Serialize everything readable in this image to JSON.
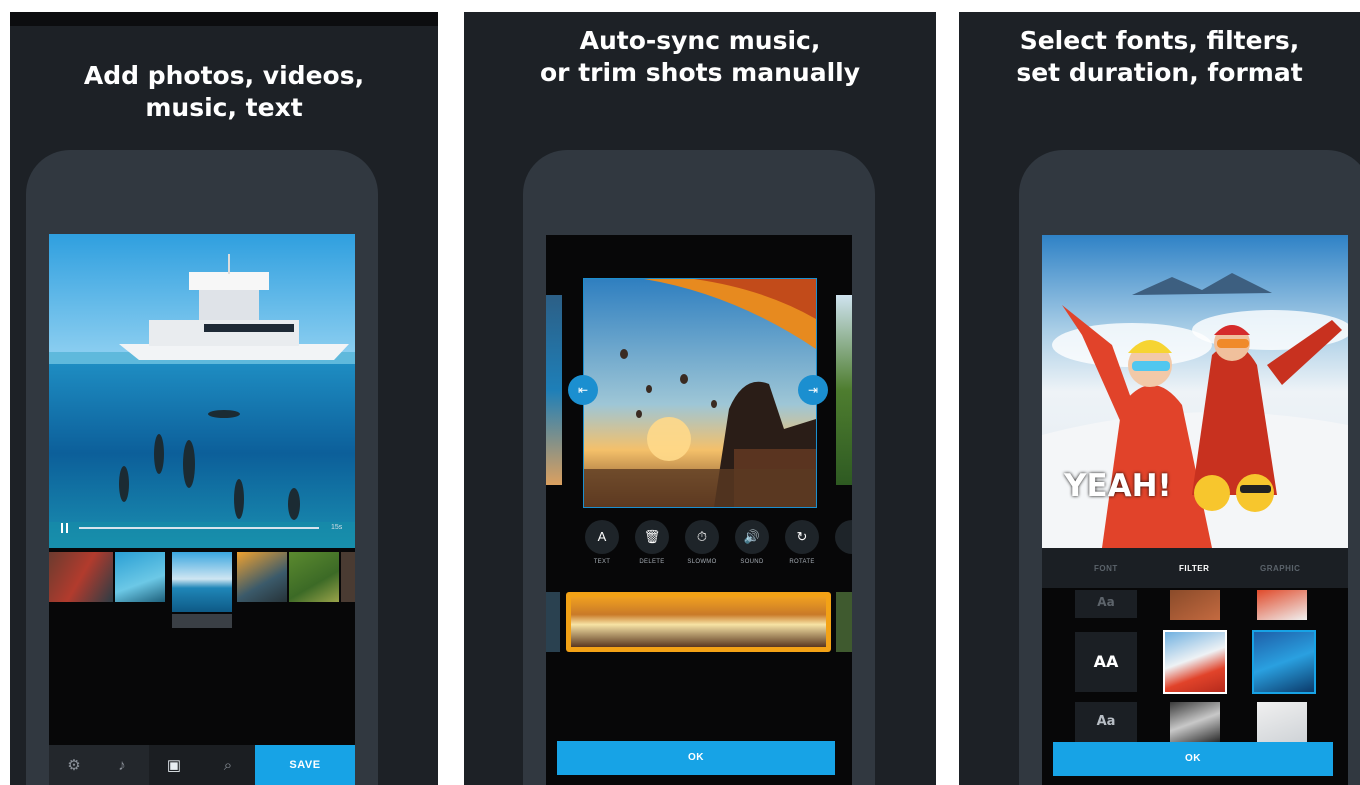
{
  "panels": [
    {
      "headline": [
        "Add photos, videos,",
        "music, text"
      ]
    },
    {
      "headline": [
        "Auto-sync music,",
        "or trim shots manually"
      ]
    },
    {
      "headline": [
        "Select fonts, filters,",
        "set duration, format"
      ]
    }
  ],
  "editor1": {
    "play_icon": "pause-icon",
    "elapsed": "15s",
    "save_label": "SAVE",
    "toolbar_icons": [
      "filter-icon",
      "music-icon",
      "media-icon",
      "search-icon"
    ]
  },
  "editor2": {
    "tools": [
      {
        "icon": "text-icon",
        "glyph": "A",
        "label": "TEXT"
      },
      {
        "icon": "delete-icon",
        "glyph": "🗑",
        "label": "DELETE"
      },
      {
        "icon": "slowmo-icon",
        "glyph": "⏱",
        "label": "SLOWMO"
      },
      {
        "icon": "sound-icon",
        "glyph": "🔊",
        "label": "SOUND"
      },
      {
        "icon": "rotate-icon",
        "glyph": "↻",
        "label": "ROTATE"
      }
    ],
    "ok_label": "OK"
  },
  "editor3": {
    "tabs": [
      "FONT",
      "FILTER",
      "GRAPHIC"
    ],
    "active_tab": "FILTER",
    "overlay_text": "YEAH!",
    "font_tiles": [
      "Aa",
      "AA",
      "Aa"
    ],
    "ok_label": "OK"
  },
  "colors": {
    "panel_bg": "#1d2126",
    "phone_body": "#313840",
    "accent": "#17a3e6"
  }
}
